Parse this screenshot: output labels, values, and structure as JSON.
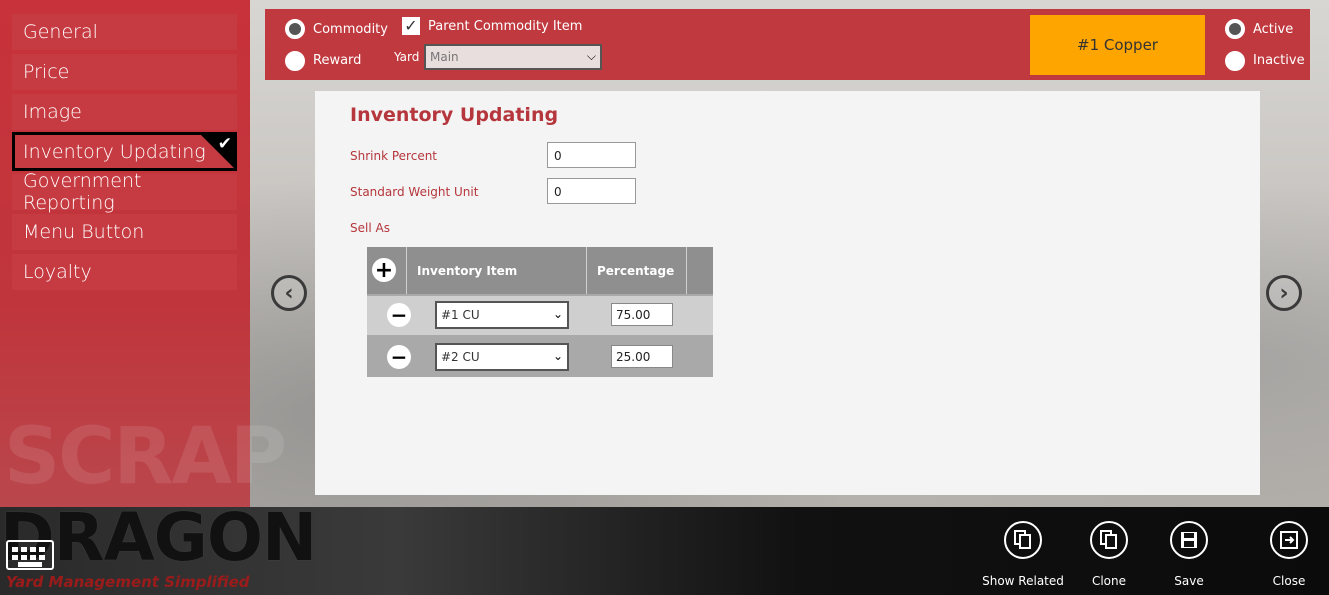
{
  "sidebar": {
    "items": [
      {
        "label": "General"
      },
      {
        "label": "Price"
      },
      {
        "label": "Image"
      },
      {
        "label": "Inventory Updating",
        "selected": true
      },
      {
        "label": "Government Reporting"
      },
      {
        "label": "Menu Button"
      },
      {
        "label": "Loyalty"
      }
    ],
    "watermark": "SCRAP"
  },
  "topbar": {
    "type_commodity": "Commodity",
    "type_reward": "Reward",
    "type_selected": "Commodity",
    "parent_commodity_label": "Parent Commodity Item",
    "parent_commodity_checked": true,
    "yard_label": "Yard",
    "yard_value": "Main",
    "commodity_name": "#1 Copper",
    "status_active": "Active",
    "status_inactive": "Inactive",
    "status_selected": "Active",
    "badge_color": "#ffa500"
  },
  "panel": {
    "title": "Inventory Updating",
    "shrink_percent_label": "Shrink Percent",
    "shrink_percent_value": "0",
    "standard_weight_unit_label": "Standard Weight Unit",
    "standard_weight_unit_value": "0",
    "sell_as_label": "Sell As",
    "grid": {
      "headers": [
        "Inventory Item",
        "Percentage"
      ],
      "rows": [
        {
          "item": "#1 CU",
          "percentage": "75.00"
        },
        {
          "item": "#2 CU",
          "percentage": "25.00"
        }
      ]
    }
  },
  "bottombar": {
    "logo": "DRAGON",
    "tagline": "Yard Management Simplified",
    "actions": [
      {
        "label": "Show Related",
        "icon": "copy-icon"
      },
      {
        "label": "Clone",
        "icon": "copy-icon"
      },
      {
        "label": "Save",
        "icon": "floppy-icon"
      },
      {
        "label": "Close",
        "icon": "exit-icon"
      }
    ]
  },
  "colors": {
    "accent_red": "#c0393f",
    "title_red": "#b5363c"
  }
}
